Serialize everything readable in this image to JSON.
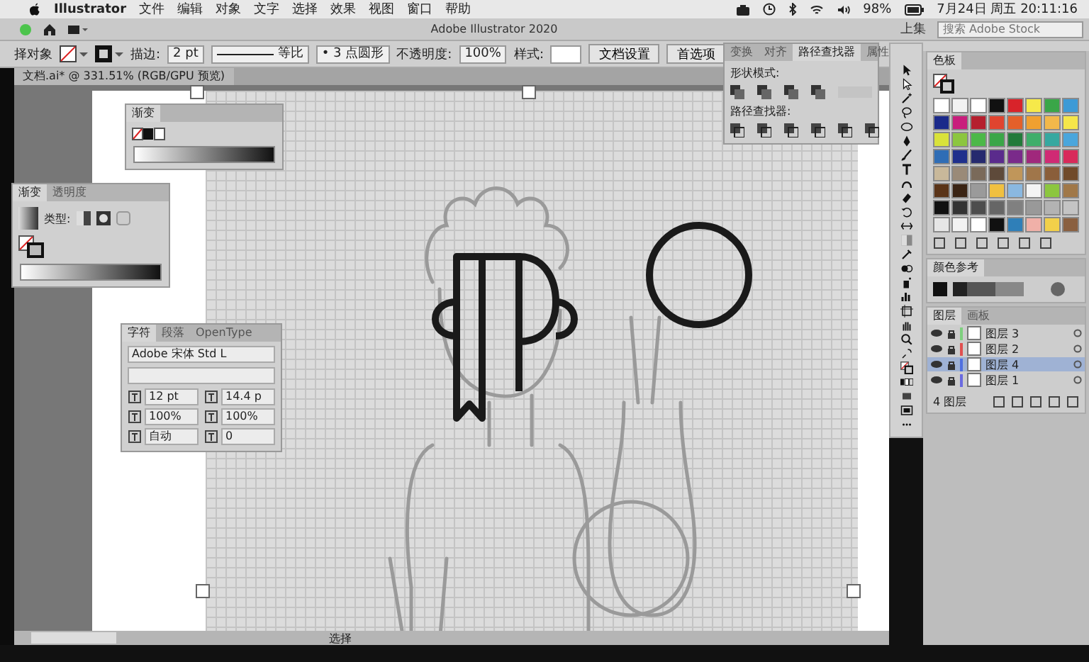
{
  "menubar": {
    "items": [
      "Illustrator",
      "文件",
      "编辑",
      "对象",
      "文字",
      "选择",
      "效果",
      "视图",
      "窗口",
      "帮助"
    ],
    "battery": "98%",
    "clock": "7月24日 周五 20:11:16"
  },
  "app_bar": {
    "title": "Adobe Illustrator 2020",
    "workspace": "上集",
    "search": {
      "placeholder": "搜索 Adobe Stock"
    }
  },
  "control_bar": {
    "selection": "择对象",
    "stroke_label": "描边:",
    "stroke_value": "2 pt",
    "profile": "等比",
    "brush": "• 3 点圆形",
    "opacity_label": "不透明度:",
    "opacity_value": "100%",
    "style_label": "样式:",
    "buttons": [
      "文档设置",
      "首选项"
    ]
  },
  "document_tab": "文档.ai* @ 331.51% (RGB/GPU 预览)",
  "gradient_mini": {
    "tabs": [
      {
        "label": "渐变",
        "selected": true
      }
    ]
  },
  "gradient_panel": {
    "tabs": [
      {
        "label": "渐变",
        "selected": true
      },
      {
        "label": "透明度",
        "selected": false
      }
    ],
    "type_label": "类型:"
  },
  "character_panel": {
    "tabs": [
      {
        "label": "字符",
        "selected": true
      },
      {
        "label": "段落",
        "selected": false
      },
      {
        "label": "OpenType",
        "selected": false
      }
    ],
    "font": "Adobe 宋体 Std L",
    "size": "12 pt",
    "leading": "14.4 p",
    "vertical_scale": "100%",
    "horizontal_scale": "100%",
    "kerning": "自动",
    "tracking": "0"
  },
  "pathfinder_panel": {
    "tabs": [
      {
        "label": "变换",
        "selected": false
      },
      {
        "label": "对齐",
        "selected": false
      },
      {
        "label": "路径查找器",
        "selected": true
      },
      {
        "label": "属性",
        "selected": false
      }
    ],
    "shape_modes_label": "形状模式:",
    "pathfinders_label": "路径查找器:"
  },
  "swatches_panel": {
    "tabs": [
      {
        "label": "色板",
        "selected": true
      }
    ],
    "swatches": [
      {
        "color": "#ffffff"
      },
      {
        "color": "#f2f2f2"
      },
      {
        "color": "#ffffff"
      },
      {
        "color": "#111111"
      },
      {
        "color": "#d8232a"
      },
      {
        "color": "#f6e94a"
      },
      {
        "color": "#3aa648"
      },
      {
        "color": "#3d9ad6"
      },
      {
        "color": "#1b2a8a"
      },
      {
        "color": "#c81e7c"
      },
      {
        "color": "#b51f2e"
      },
      {
        "color": "#e0442f"
      },
      {
        "color": "#e4602a"
      },
      {
        "color": "#f0a030"
      },
      {
        "color": "#f2b84a"
      },
      {
        "color": "#f5e64a"
      },
      {
        "color": "#d9e23a"
      },
      {
        "color": "#8cc63f"
      },
      {
        "color": "#4cb848"
      },
      {
        "color": "#3aa648"
      },
      {
        "color": "#237a3a"
      },
      {
        "color": "#3fae6a"
      },
      {
        "color": "#36a8a0"
      },
      {
        "color": "#4aa6dc"
      },
      {
        "color": "#2f6db5"
      },
      {
        "color": "#1f2f8c"
      },
      {
        "color": "#262a6e"
      },
      {
        "color": "#5a2b8c"
      },
      {
        "color": "#7a2a8a"
      },
      {
        "color": "#a0287c"
      },
      {
        "color": "#d02a74"
      },
      {
        "color": "#d82a5a"
      },
      {
        "color": "#c8b89a"
      },
      {
        "color": "#9a8a78"
      },
      {
        "color": "#7a6a5a"
      },
      {
        "color": "#5e4a3a"
      },
      {
        "color": "#c0965a"
      },
      {
        "color": "#a0764a"
      },
      {
        "color": "#8a5e3a"
      },
      {
        "color": "#704a2a"
      },
      {
        "color": "#5a3418"
      },
      {
        "color": "#3a2414"
      },
      {
        "color": "#9a9a9a"
      },
      {
        "color": "#f0c040"
      },
      {
        "color": "#8ab8e0"
      },
      {
        "color": "#f4f4f4"
      },
      {
        "color": "#8cc63f"
      },
      {
        "color": "#a07848"
      },
      {
        "color": "#111111"
      },
      {
        "color": "#333333"
      },
      {
        "color": "#4d4d4d"
      },
      {
        "color": "#666666"
      },
      {
        "color": "#808080"
      },
      {
        "color": "#999999"
      },
      {
        "color": "#b3b3b3"
      },
      {
        "color": "#c4c4c4"
      },
      {
        "color": "#e6e6e6"
      },
      {
        "color": "#f2f2f2"
      },
      {
        "color": "#ffffff"
      },
      {
        "color": "#111111"
      },
      {
        "color": "#2f7fb8"
      },
      {
        "color": "#f0b0a8"
      },
      {
        "color": "#f2d04a"
      },
      {
        "color": "#8a6040"
      }
    ]
  },
  "color_guide_panel": {
    "tabs": [
      {
        "label": "颜色参考",
        "selected": true
      }
    ]
  },
  "layers_panel": {
    "tabs": [
      {
        "label": "图层",
        "selected": true
      },
      {
        "label": "画板",
        "selected": false
      }
    ],
    "layers": [
      {
        "name": "图层 3",
        "color": "#7ed07e",
        "selected": false
      },
      {
        "name": "图层 2",
        "color": "#e05050",
        "selected": false
      },
      {
        "name": "图层 4",
        "color": "#4f6fe0",
        "selected": true
      },
      {
        "name": "图层 1",
        "color": "#6a6ae0",
        "selected": false
      }
    ],
    "footer": "4 图层"
  },
  "status_bar": {
    "tool": "选择"
  }
}
